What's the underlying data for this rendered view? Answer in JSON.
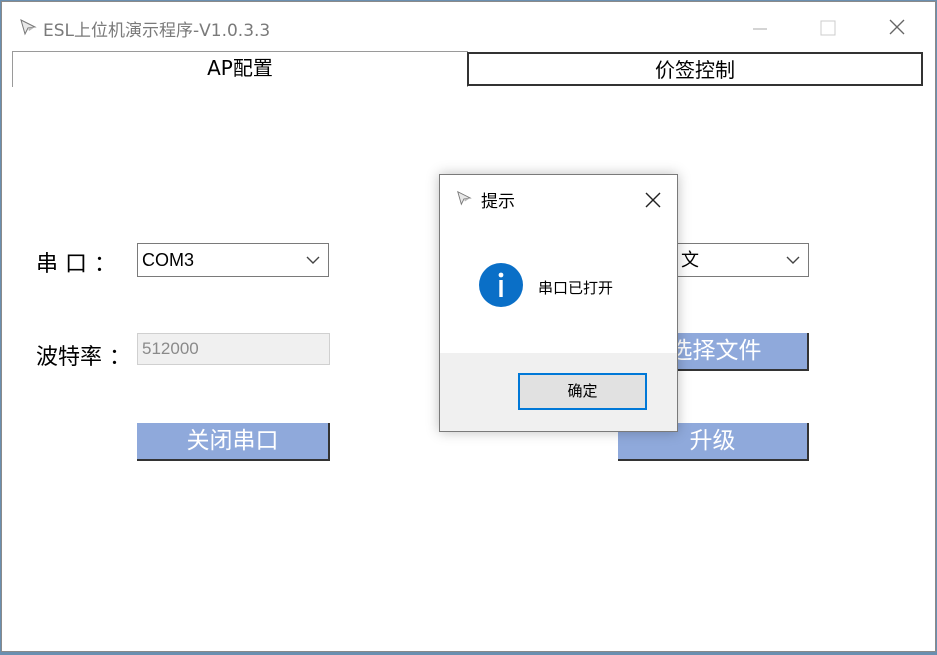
{
  "window": {
    "title": "ESL上位机演示程序-V1.0.3.3",
    "controls": {
      "minimize": "minimize",
      "maximize": "maximize",
      "close": "close"
    }
  },
  "tabs": [
    {
      "label": "AP配置",
      "active": true
    },
    {
      "label": "价签控制",
      "active": false
    }
  ],
  "serial": {
    "port_label": "串  口 ：",
    "port_value": "COM3",
    "baud_label": "波特率 ：",
    "baud_value": "512000",
    "close_button": "关闭串口"
  },
  "firmware": {
    "file_combo_value": "文",
    "select_file_button": "选择文件",
    "upgrade_button": "升级"
  },
  "dialog": {
    "title": "提示",
    "message": "串口已打开",
    "ok_button": "确定",
    "icon": "info-icon"
  },
  "colors": {
    "button_fill": "#8fa9db",
    "dialog_focus": "#0078d7",
    "info_icon": "#0a6fc7"
  }
}
